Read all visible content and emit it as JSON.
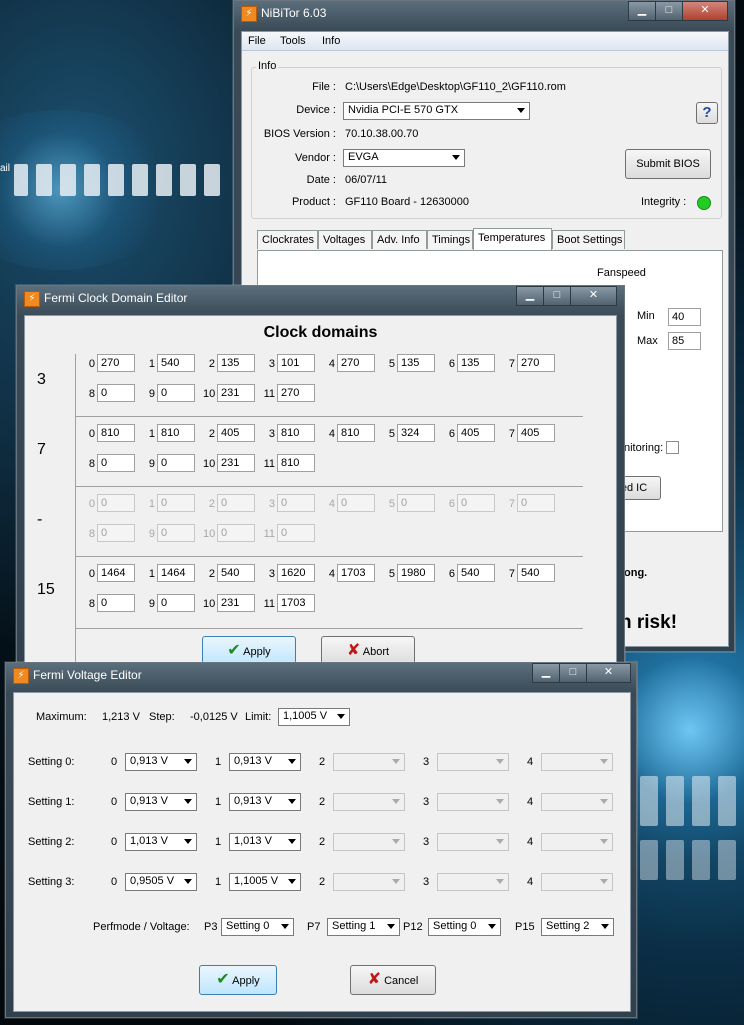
{
  "desktop": {
    "side_text": "ail"
  },
  "nibitor": {
    "title": "NiBiTor 6.03",
    "menu": [
      "File",
      "Tools",
      "Info"
    ],
    "info_group": "Info",
    "file_label": "File :",
    "file_value": "C:\\Users\\Edge\\Desktop\\GF110_2\\GF110.rom",
    "device_label": "Device :",
    "device_value": "Nvidia PCI-E 570 GTX",
    "bios_label": "BIOS Version :",
    "bios_value": "70.10.38.00.70",
    "vendor_label": "Vendor :",
    "vendor_value": "EVGA",
    "date_label": "Date :",
    "date_value": "06/07/11",
    "product_label": "Product :",
    "product_value": "GF110 Board - 12630000",
    "help_glyph": "?",
    "submit_label": "Submit BIOS",
    "integrity_label": "Integrity :",
    "integrity_color": "#22cc22",
    "tabs": [
      "Clockrates",
      "Voltages",
      "Adv. Info",
      "Timings",
      "Temperatures",
      "Boot Settings"
    ],
    "active_tab": "Temperatures",
    "fanspeed_label": "Fanspeed",
    "fan_min_label": "Min",
    "fan_min_value": "40",
    "fan_max_label": "Max",
    "fan_max_value": "85",
    "monitoring_label": "nitoring:",
    "ic_button": "ed IC",
    "note_text": "ong.",
    "risk_text": "n risk!"
  },
  "clock": {
    "title": "Fermi Clock Domain Editor",
    "heading": "Clock domains",
    "rows": [
      {
        "label": "3",
        "disabled": false,
        "fields": [
          {
            "n": "0",
            "v": "270"
          },
          {
            "n": "1",
            "v": "540"
          },
          {
            "n": "2",
            "v": "135"
          },
          {
            "n": "3",
            "v": "101"
          },
          {
            "n": "4",
            "v": "270"
          },
          {
            "n": "5",
            "v": "135"
          },
          {
            "n": "6",
            "v": "135"
          },
          {
            "n": "7",
            "v": "270"
          },
          {
            "n": "8",
            "v": "0"
          },
          {
            "n": "9",
            "v": "0"
          },
          {
            "n": "10",
            "v": "231"
          },
          {
            "n": "11",
            "v": "270"
          }
        ]
      },
      {
        "label": "7",
        "disabled": false,
        "fields": [
          {
            "n": "0",
            "v": "810"
          },
          {
            "n": "1",
            "v": "810"
          },
          {
            "n": "2",
            "v": "405"
          },
          {
            "n": "3",
            "v": "810"
          },
          {
            "n": "4",
            "v": "810"
          },
          {
            "n": "5",
            "v": "324"
          },
          {
            "n": "6",
            "v": "405"
          },
          {
            "n": "7",
            "v": "405"
          },
          {
            "n": "8",
            "v": "0"
          },
          {
            "n": "9",
            "v": "0"
          },
          {
            "n": "10",
            "v": "231"
          },
          {
            "n": "11",
            "v": "810"
          }
        ]
      },
      {
        "label": "-",
        "disabled": true,
        "fields": [
          {
            "n": "0",
            "v": "0"
          },
          {
            "n": "1",
            "v": "0"
          },
          {
            "n": "2",
            "v": "0"
          },
          {
            "n": "3",
            "v": "0"
          },
          {
            "n": "4",
            "v": "0"
          },
          {
            "n": "5",
            "v": "0"
          },
          {
            "n": "6",
            "v": "0"
          },
          {
            "n": "7",
            "v": "0"
          },
          {
            "n": "8",
            "v": "0"
          },
          {
            "n": "9",
            "v": "0"
          },
          {
            "n": "10",
            "v": "0"
          },
          {
            "n": "11",
            "v": "0"
          }
        ]
      },
      {
        "label": "15",
        "disabled": false,
        "fields": [
          {
            "n": "0",
            "v": "1464"
          },
          {
            "n": "1",
            "v": "1464"
          },
          {
            "n": "2",
            "v": "540"
          },
          {
            "n": "3",
            "v": "1620"
          },
          {
            "n": "4",
            "v": "1703"
          },
          {
            "n": "5",
            "v": "1980"
          },
          {
            "n": "6",
            "v": "540"
          },
          {
            "n": "7",
            "v": "540"
          },
          {
            "n": "8",
            "v": "0"
          },
          {
            "n": "9",
            "v": "0"
          },
          {
            "n": "10",
            "v": "231"
          },
          {
            "n": "11",
            "v": "1703"
          }
        ]
      }
    ],
    "apply_label": "Apply",
    "abort_label": "Abort"
  },
  "voltage": {
    "title": "Fermi Voltage Editor",
    "maximum_label": "Maximum:",
    "maximum_value": "1,213 V",
    "step_label": "Step:",
    "step_value": "-0,0125 V",
    "limit_label": "Limit:",
    "limit_value": "1,1005 V",
    "settings": [
      {
        "label": "Setting 0:",
        "v0": "0,913 V",
        "v1": "0,913 V"
      },
      {
        "label": "Setting 1:",
        "v0": "0,913 V",
        "v1": "0,913 V"
      },
      {
        "label": "Setting 2:",
        "v0": "1,013 V",
        "v1": "1,013 V"
      },
      {
        "label": "Setting 3:",
        "v0": "0,9505 V",
        "v1": "1,1005 V"
      }
    ],
    "col_labels": [
      "0",
      "1",
      "2",
      "3",
      "4"
    ],
    "perf_label": "Perfmode / Voltage:",
    "perf": [
      {
        "p": "P3",
        "v": "Setting 0"
      },
      {
        "p": "P7",
        "v": "Setting 1"
      },
      {
        "p": "P12",
        "v": "Setting 0"
      },
      {
        "p": "P15",
        "v": "Setting 2"
      }
    ],
    "apply_label": "Apply",
    "cancel_label": "Cancel"
  }
}
